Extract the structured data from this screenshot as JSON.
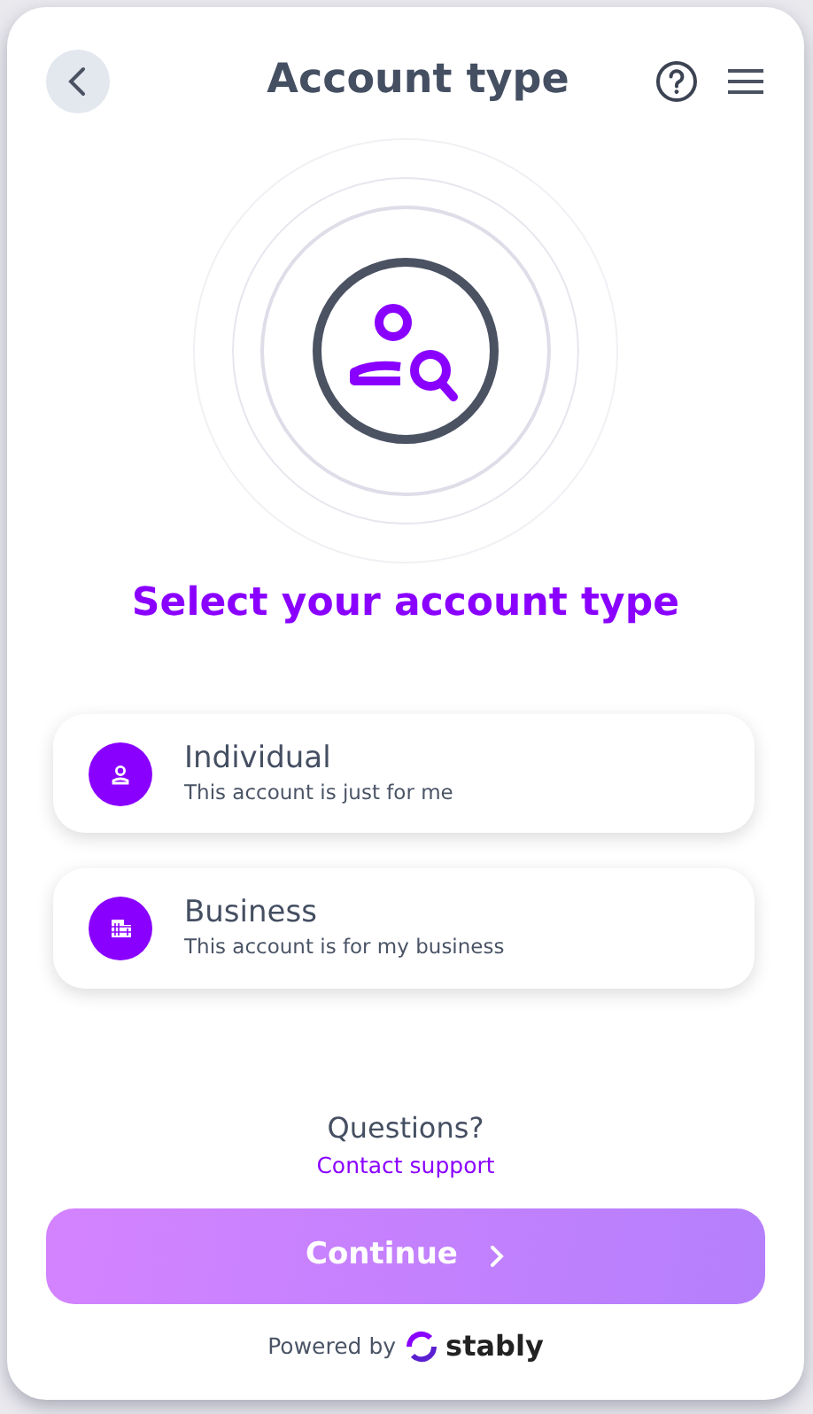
{
  "header": {
    "title": "Account type"
  },
  "heading": "Select your account type",
  "options": [
    {
      "kind": "person",
      "title": "Individual",
      "subtitle": "This account is just for me",
      "selected": false
    },
    {
      "kind": "building",
      "title": "Business",
      "subtitle": "This account is for my business",
      "selected": false
    }
  ],
  "help": {
    "question": "Questions?",
    "link": "Contact support"
  },
  "continue_button": {
    "label": "Continue",
    "disabled": true
  },
  "footer": {
    "powered_by": "Powered by",
    "brand": "stably"
  }
}
